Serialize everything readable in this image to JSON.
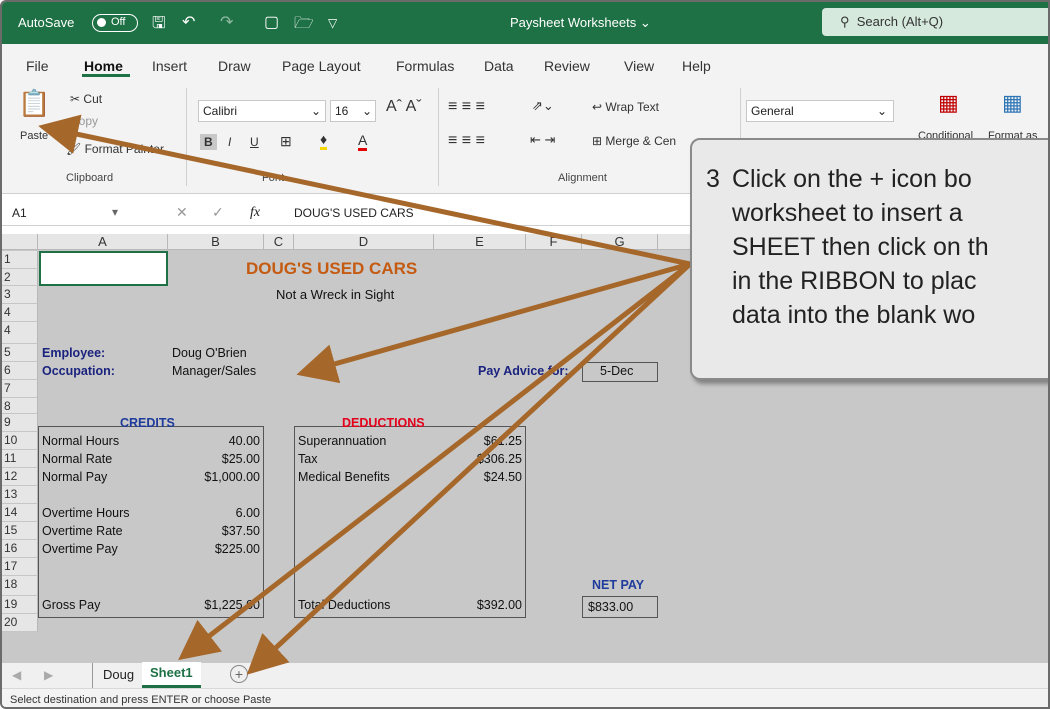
{
  "titlebar": {
    "autosave_label": "AutoSave",
    "autosave_state": "Off",
    "document_title": "Paysheet Worksheets",
    "search_placeholder": "Search (Alt+Q)"
  },
  "menu": [
    "File",
    "Home",
    "Insert",
    "Draw",
    "Page Layout",
    "Formulas",
    "Data",
    "Review",
    "View",
    "Help"
  ],
  "ribbon": {
    "clipboard": {
      "paste": "Paste",
      "cut": "Cut",
      "copy": "Copy",
      "format_painter": "Format Painter",
      "label": "Clipboard"
    },
    "font": {
      "name": "Calibri",
      "size": "16",
      "bold": "B",
      "italic": "I",
      "underline": "U",
      "label": "Font"
    },
    "alignment": {
      "wrap_text": "Wrap Text",
      "merge_center": "Merge & Cen",
      "label": "Alignment"
    },
    "number": {
      "format": "General"
    },
    "styles": {
      "conditional": "Conditional",
      "format_as": "Format as"
    }
  },
  "formula_bar": {
    "name_box": "A1",
    "fx": "fx",
    "content": "DOUG'S USED CARS"
  },
  "columns": [
    "A",
    "B",
    "C",
    "D",
    "E",
    "F",
    "G"
  ],
  "rows": [
    "1",
    "2",
    "3",
    "4",
    "4",
    "5",
    "6",
    "7",
    "8",
    "9",
    "10",
    "11",
    "12",
    "13",
    "14",
    "15",
    "16",
    "17",
    "18",
    "19",
    "20"
  ],
  "sheet": {
    "title": "DOUG'S USED CARS",
    "subtitle": "Not a Wreck in Sight",
    "employee_label": "Employee:",
    "employee_value": "Doug O'Brien",
    "occupation_label": "Occupation:",
    "occupation_value": "Manager/Sales",
    "pay_advice_label": "Pay Advice for:",
    "pay_advice_value": "5-Dec",
    "credits_header": "CREDITS",
    "deductions_header": "DEDUCTIONS",
    "credits": [
      {
        "label": "Normal Hours",
        "value": "40.00"
      },
      {
        "label": "Normal Rate",
        "value": "$25.00"
      },
      {
        "label": "Normal Pay",
        "value": "$1,000.00"
      },
      {
        "label": "Overtime Hours",
        "value": "6.00"
      },
      {
        "label": "Overtime Rate",
        "value": "$37.50"
      },
      {
        "label": "Overtime Pay",
        "value": "$225.00"
      },
      {
        "label": "Gross Pay",
        "value": "$1,225.00"
      }
    ],
    "deductions": [
      {
        "label": "Superannuation",
        "value": "$61.25"
      },
      {
        "label": "Tax",
        "value": "$306.25"
      },
      {
        "label": "Medical Benefits",
        "value": "$24.50"
      },
      {
        "label": "Total Deductions",
        "value": "$392.00"
      }
    ],
    "net_pay_label": "NET PAY",
    "net_pay_value": "$833.00"
  },
  "tabs": {
    "sheet_doug": "Doug",
    "sheet_new": "Sheet1",
    "add_symbol": "+"
  },
  "status": "Select destination and press ENTER or choose Paste",
  "callout": {
    "number": "3",
    "text": "Click on the + icon bo\nworksheet to insert a \nSHEET then click on th\nin the RIBBON to plac\ndata into the blank wo"
  },
  "colors": {
    "excel_green": "#1e7145",
    "title_orange": "#c55a11",
    "credits_blue": "#1f3b9c",
    "deductions_red": "#e3001b",
    "arrow_brown": "#a5672a"
  }
}
